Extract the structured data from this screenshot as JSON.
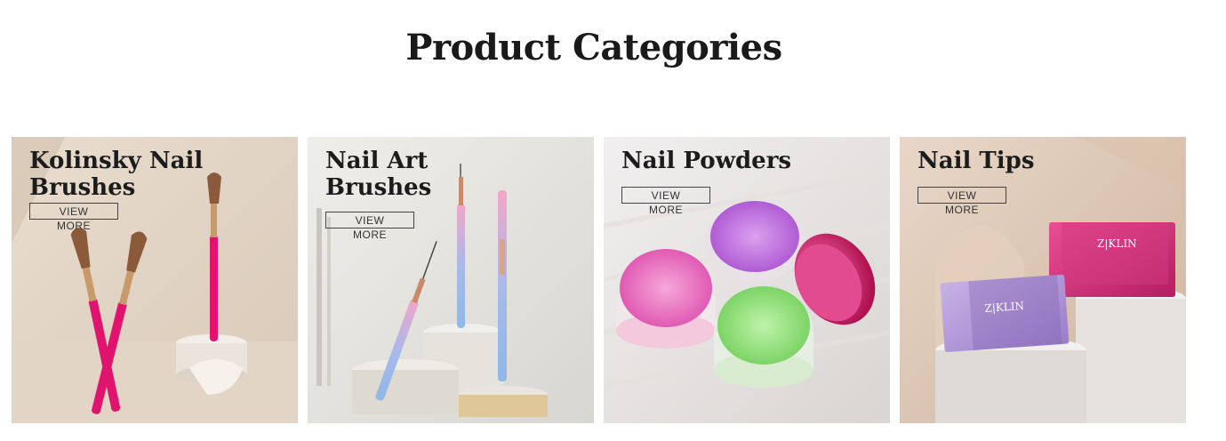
{
  "section": {
    "title": "Product Categories"
  },
  "categories": [
    {
      "name": "Kolinsky Nail Brushes",
      "button": "VIEW MORE",
      "accent": "#e0146f"
    },
    {
      "name": "Nail Art Brushes",
      "button": "VIEW MORE",
      "accent": "#8fb8e8"
    },
    {
      "name": "Nail Powders",
      "button": "VIEW MORE",
      "accent": "#d45fd8"
    },
    {
      "name": "Nail Tips",
      "button": "VIEW MORE",
      "accent": "#c9307a"
    }
  ]
}
